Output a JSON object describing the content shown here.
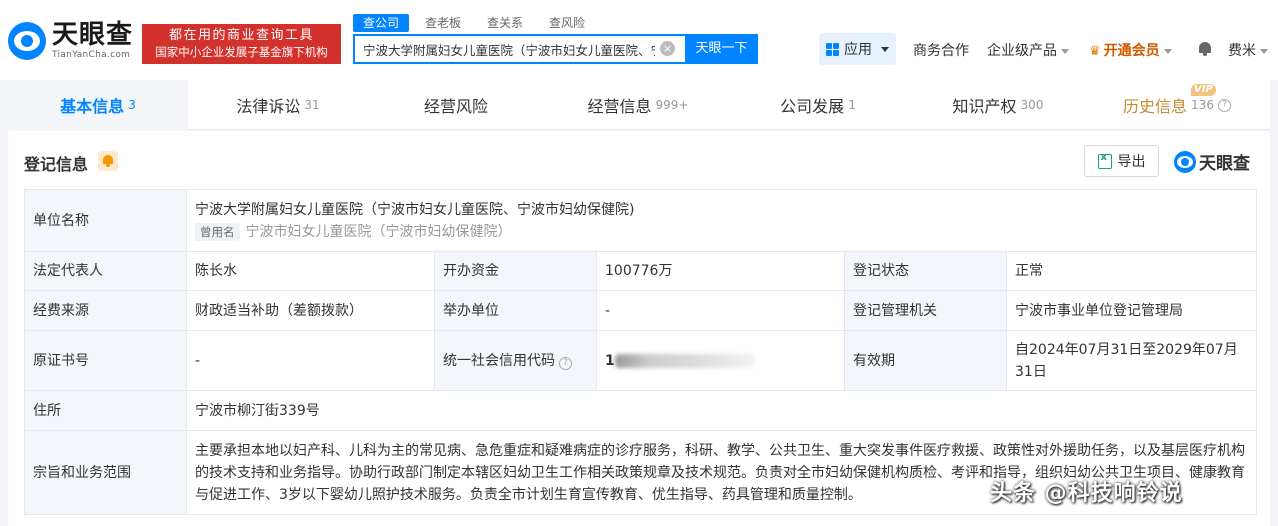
{
  "header": {
    "logo_cn": "天眼查",
    "logo_en": "TianYanCha.com",
    "slogan_line1": "都在用的商业查询工具",
    "slogan_line2": "国家中小企业发展子基金旗下机构",
    "search_tabs": [
      "查公司",
      "查老板",
      "查关系",
      "查风险"
    ],
    "search_value": "宁波大学附属妇女儿童医院（宁波市妇女儿童医院、宁",
    "search_button": "天眼一下",
    "nav": {
      "app": "应用",
      "cooperation": "商务合作",
      "enterprise": "企业级产品",
      "vip": "开通会员",
      "user": "费米"
    }
  },
  "tabs": [
    {
      "label": "基本信息",
      "count": "3"
    },
    {
      "label": "法律诉讼",
      "count": "31"
    },
    {
      "label": "经营风险",
      "count": ""
    },
    {
      "label": "经营信息",
      "count": "999+"
    },
    {
      "label": "公司发展",
      "count": "1"
    },
    {
      "label": "知识产权",
      "count": "300"
    },
    {
      "label": "历史信息",
      "count": "136",
      "badge": "VIP"
    }
  ],
  "section": {
    "title": "登记信息",
    "export_label": "导出",
    "brand": "天眼查"
  },
  "registration": {
    "unit_name_label": "单位名称",
    "unit_name": "宁波大学附属妇女儿童医院（宁波市妇女儿童医院、宁波市妇幼保健院)",
    "former_name_tag": "曾用名",
    "former_name": "宁波市妇女儿童医院（宁波市妇幼保健院）",
    "legal_rep_label": "法定代表人",
    "legal_rep": "陈长水",
    "funds_label": "开办资金",
    "funds": "100776万",
    "status_label": "登记状态",
    "status": "正常",
    "funding_source_label": "经费来源",
    "funding_source": "财政适当补助（差额拨款）",
    "sponsor_label": "举办单位",
    "sponsor": "-",
    "authority_label": "登记管理机关",
    "authority": "宁波市事业单位登记管理局",
    "cert_no_label": "原证书号",
    "cert_no": "-",
    "credit_code_label": "统一社会信用代码",
    "credit_code_first": "1",
    "validity_label": "有效期",
    "validity": "自2024年07月31日至2029年07月31日",
    "address_label": "住所",
    "address": "宁波市柳汀街339号",
    "scope_label": "宗旨和业务范围",
    "scope": "主要承担本地以妇产科、儿科为主的常见病、急危重症和疑难病症的诊疗服务，科研、教学、公共卫生、重大突发事件医疗救援、政策性对外援助任务，以及基层医疗机构的技术支持和业务指导。协助行政部门制定本辖区妇幼卫生工作相关政策规章及技术规范。负责对全市妇幼保健机构质检、考评和指导，组织妇幼公共卫生项目、健康教育与促进工作、3岁以下婴幼儿照护技术服务。负责全市计划生育宣传教育、优生指导、药具管理和质量控制。"
  },
  "watermark": "头条 @科技响铃说"
}
